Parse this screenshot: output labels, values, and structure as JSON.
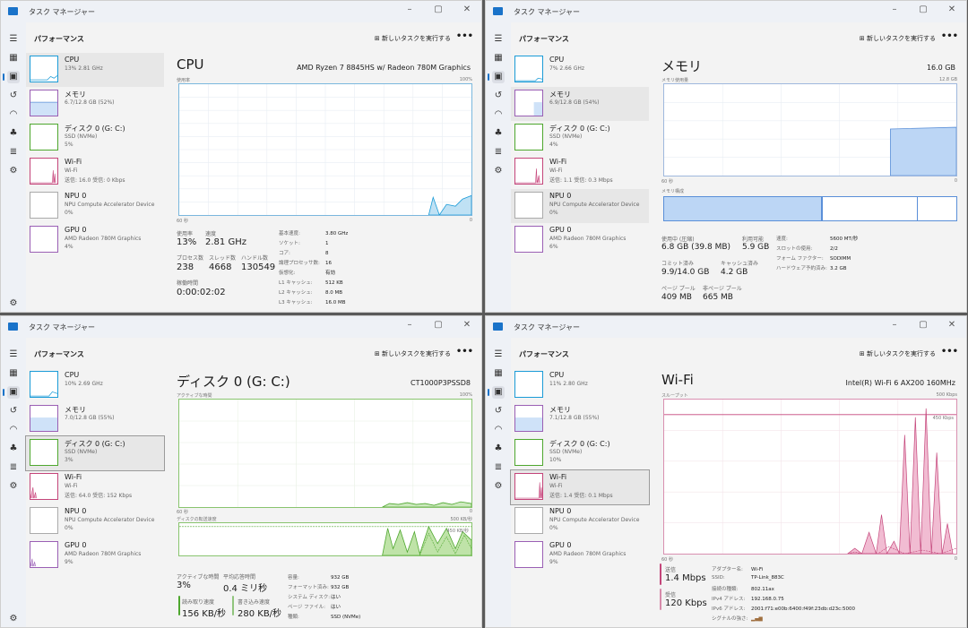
{
  "windows": [
    {
      "title": "タスク マネージャー",
      "header": {
        "page_title": "パフォーマンス",
        "run_task": "新しいタスクを実行する",
        "more": "•••"
      },
      "tiles": [
        {
          "name": "CPU",
          "sub1": "13% 2.81 GHz",
          "sub2": ""
        },
        {
          "name": "メモリ",
          "sub1": "6.7/12.8 GB (52%)",
          "sub2": ""
        },
        {
          "name": "ディスク 0 (G: C:)",
          "sub1": "SSD (NVMe)",
          "sub2": "5%"
        },
        {
          "name": "Wi-Fi",
          "sub1": "Wi-Fi",
          "sub2": "送信: 16.0 受信: 0 Kbps"
        },
        {
          "name": "NPU 0",
          "sub1": "NPU Compute Accelerator Device",
          "sub2": "0%"
        },
        {
          "name": "GPU 0",
          "sub1": "AMD Radeon 780M Graphics",
          "sub2": "4%"
        }
      ],
      "main": {
        "title": "CPU",
        "model": "AMD Ryzen 7 8845HS w/ Radeon 780M Graphics",
        "graph_label": "使用率",
        "graph_max": "100%",
        "time_label": "60 秒",
        "time_end": "0",
        "stats": [
          {
            "label": "使用率",
            "value": "13%"
          },
          {
            "label": "速度",
            "value": "2.81 GHz"
          },
          {
            "label": "プロセス数",
            "value": "238"
          },
          {
            "label": "スレッド数",
            "value": "4668"
          },
          {
            "label": "ハンドル数",
            "value": "130549"
          },
          {
            "label": "稼働時間",
            "value": "0:00:02:02"
          }
        ],
        "kv": [
          {
            "k": "基本速度:",
            "v": "3.80 GHz"
          },
          {
            "k": "ソケット:",
            "v": "1"
          },
          {
            "k": "コア:",
            "v": "8"
          },
          {
            "k": "論理プロセッサ数:",
            "v": "16"
          },
          {
            "k": "仮想化:",
            "v": "有効"
          },
          {
            "k": "L1 キャッシュ:",
            "v": "512 KB"
          },
          {
            "k": "L2 キャッシュ:",
            "v": "8.0 MB"
          },
          {
            "k": "L3 キャッシュ:",
            "v": "16.0 MB"
          }
        ]
      }
    },
    {
      "title": "タスク マネージャー",
      "header": {
        "page_title": "パフォーマンス",
        "run_task": "新しいタスクを実行する",
        "more": "•••"
      },
      "tiles": [
        {
          "name": "CPU",
          "sub1": "7% 2.66 GHz",
          "sub2": ""
        },
        {
          "name": "メモリ",
          "sub1": "6.9/12.8 GB (54%)",
          "sub2": ""
        },
        {
          "name": "ディスク 0 (G: C:)",
          "sub1": "SSD (NVMe)",
          "sub2": "4%"
        },
        {
          "name": "Wi-Fi",
          "sub1": "Wi-Fi",
          "sub2": "送信: 1.1 受信: 0.3 Mbps"
        },
        {
          "name": "NPU 0",
          "sub1": "NPU Compute Accelerator Device",
          "sub2": "0%"
        },
        {
          "name": "GPU 0",
          "sub1": "AMD Radeon 780M Graphics",
          "sub2": "6%"
        }
      ],
      "main": {
        "title": "メモリ",
        "total": "16.0 GB",
        "graph_label": "メモリ使用量",
        "graph_max": "12.8 GB",
        "time_label": "60 秒",
        "time_end": "0",
        "comp_label": "メモリ構成",
        "stats": [
          {
            "label": "使用中 (圧縮)",
            "value": "6.8 GB (39.8 MB)"
          },
          {
            "label": "利用可能",
            "value": "5.9 GB"
          },
          {
            "label": "コミット済み",
            "value": "9.9/14.0 GB"
          },
          {
            "label": "キャッシュ済み",
            "value": "4.2 GB"
          },
          {
            "label": "ページ プール",
            "value": "409 MB"
          },
          {
            "label": "非ページ プール",
            "value": "665 MB"
          }
        ],
        "kv": [
          {
            "k": "速度:",
            "v": "5600 MT/秒"
          },
          {
            "k": "スロットの使用:",
            "v": "2/2"
          },
          {
            "k": "フォーム ファクター:",
            "v": "SODIMM"
          },
          {
            "k": "ハードウェア予約済み:",
            "v": "3.2 GB"
          }
        ]
      }
    },
    {
      "title": "タスク マネージャー",
      "header": {
        "page_title": "パフォーマンス",
        "run_task": "新しいタスクを実行する",
        "more": "•••"
      },
      "tiles": [
        {
          "name": "CPU",
          "sub1": "10% 2.69 GHz",
          "sub2": ""
        },
        {
          "name": "メモリ",
          "sub1": "7.0/12.8 GB (55%)",
          "sub2": ""
        },
        {
          "name": "ディスク 0 (G: C:)",
          "sub1": "SSD (NVMe)",
          "sub2": "3%"
        },
        {
          "name": "Wi-Fi",
          "sub1": "Wi-Fi",
          "sub2": "送信: 64.0 受信: 152 Kbps"
        },
        {
          "name": "NPU 0",
          "sub1": "NPU Compute Accelerator Device",
          "sub2": "0%"
        },
        {
          "name": "GPU 0",
          "sub1": "AMD Radeon 780M Graphics",
          "sub2": "9%"
        }
      ],
      "main": {
        "title": "ディスク 0 (G: C:)",
        "model": "CT1000P3PSSD8",
        "graph_label": "アクティブな時間",
        "graph_max": "100%",
        "time_label": "60 秒",
        "time_end": "0",
        "graph2_label": "ディスクの転送速度",
        "graph2_max": "500 KB/秒",
        "graph2_mark": "450 KB/秒",
        "stats": [
          {
            "label": "アクティブな時間",
            "value": "3%"
          },
          {
            "label": "平均応答時間",
            "value": "0.4 ミリ秒"
          },
          {
            "label": "読み取り速度",
            "value": "156 KB/秒"
          },
          {
            "label": "書き込み速度",
            "value": "280 KB/秒"
          }
        ],
        "kv": [
          {
            "k": "容量:",
            "v": "932 GB"
          },
          {
            "k": "フォーマット済み:",
            "v": "932 GB"
          },
          {
            "k": "システム ディスク:",
            "v": "はい"
          },
          {
            "k": "ページ ファイル:",
            "v": "はい"
          },
          {
            "k": "種類:",
            "v": "SSD (NVMe)"
          }
        ]
      }
    },
    {
      "title": "タスク マネージャー",
      "header": {
        "page_title": "パフォーマンス",
        "run_task": "新しいタスクを実行する",
        "more": "•••"
      },
      "tiles": [
        {
          "name": "CPU",
          "sub1": "11% 2.80 GHz",
          "sub2": ""
        },
        {
          "name": "メモリ",
          "sub1": "7.1/12.8 GB (55%)",
          "sub2": ""
        },
        {
          "name": "ディスク 0 (G: C:)",
          "sub1": "SSD (NVMe)",
          "sub2": "10%"
        },
        {
          "name": "Wi-Fi",
          "sub1": "Wi-Fi",
          "sub2": "送信: 1.4 受信: 0.1 Mbps"
        },
        {
          "name": "NPU 0",
          "sub1": "NPU Compute Accelerator Device",
          "sub2": "0%"
        },
        {
          "name": "GPU 0",
          "sub1": "AMD Radeon 780M Graphics",
          "sub2": "9%"
        }
      ],
      "main": {
        "title": "Wi-Fi",
        "model": "Intel(R) Wi-Fi 6 AX200 160MHz",
        "graph_label": "スループット",
        "graph_max": "500 Kbps",
        "graph_mark": "450 Kbps",
        "time_label": "60 秒",
        "time_end": "0",
        "stats": [
          {
            "label": "送信",
            "value": "1.4 Mbps"
          },
          {
            "label": "受信",
            "value": "120 Kbps"
          }
        ],
        "kv": [
          {
            "k": "アダプター名:",
            "v": "Wi-Fi"
          },
          {
            "k": "SSID:",
            "v": "TP-Link_883C"
          },
          {
            "k": "接続の種類:",
            "v": "802.11ax"
          },
          {
            "k": "IPv4 アドレス:",
            "v": "192.168.0.75"
          },
          {
            "k": "IPv6 アドレス:",
            "v": "2001:f71:e00b:6400:f49f:23db:d23c:5000"
          },
          {
            "k": "シグナルの強さ:",
            "v": ""
          }
        ]
      }
    }
  ],
  "colors": {
    "cpu": "#1a9bd7",
    "memory": "#9a5fb4",
    "disk": "#4ea72e",
    "wifi": "#c4457a"
  },
  "icons": [
    "hamburger-icon",
    "processes-icon",
    "performance-icon",
    "history-icon",
    "startup-icon",
    "users-icon",
    "details-icon",
    "services-icon",
    "settings-icon"
  ]
}
